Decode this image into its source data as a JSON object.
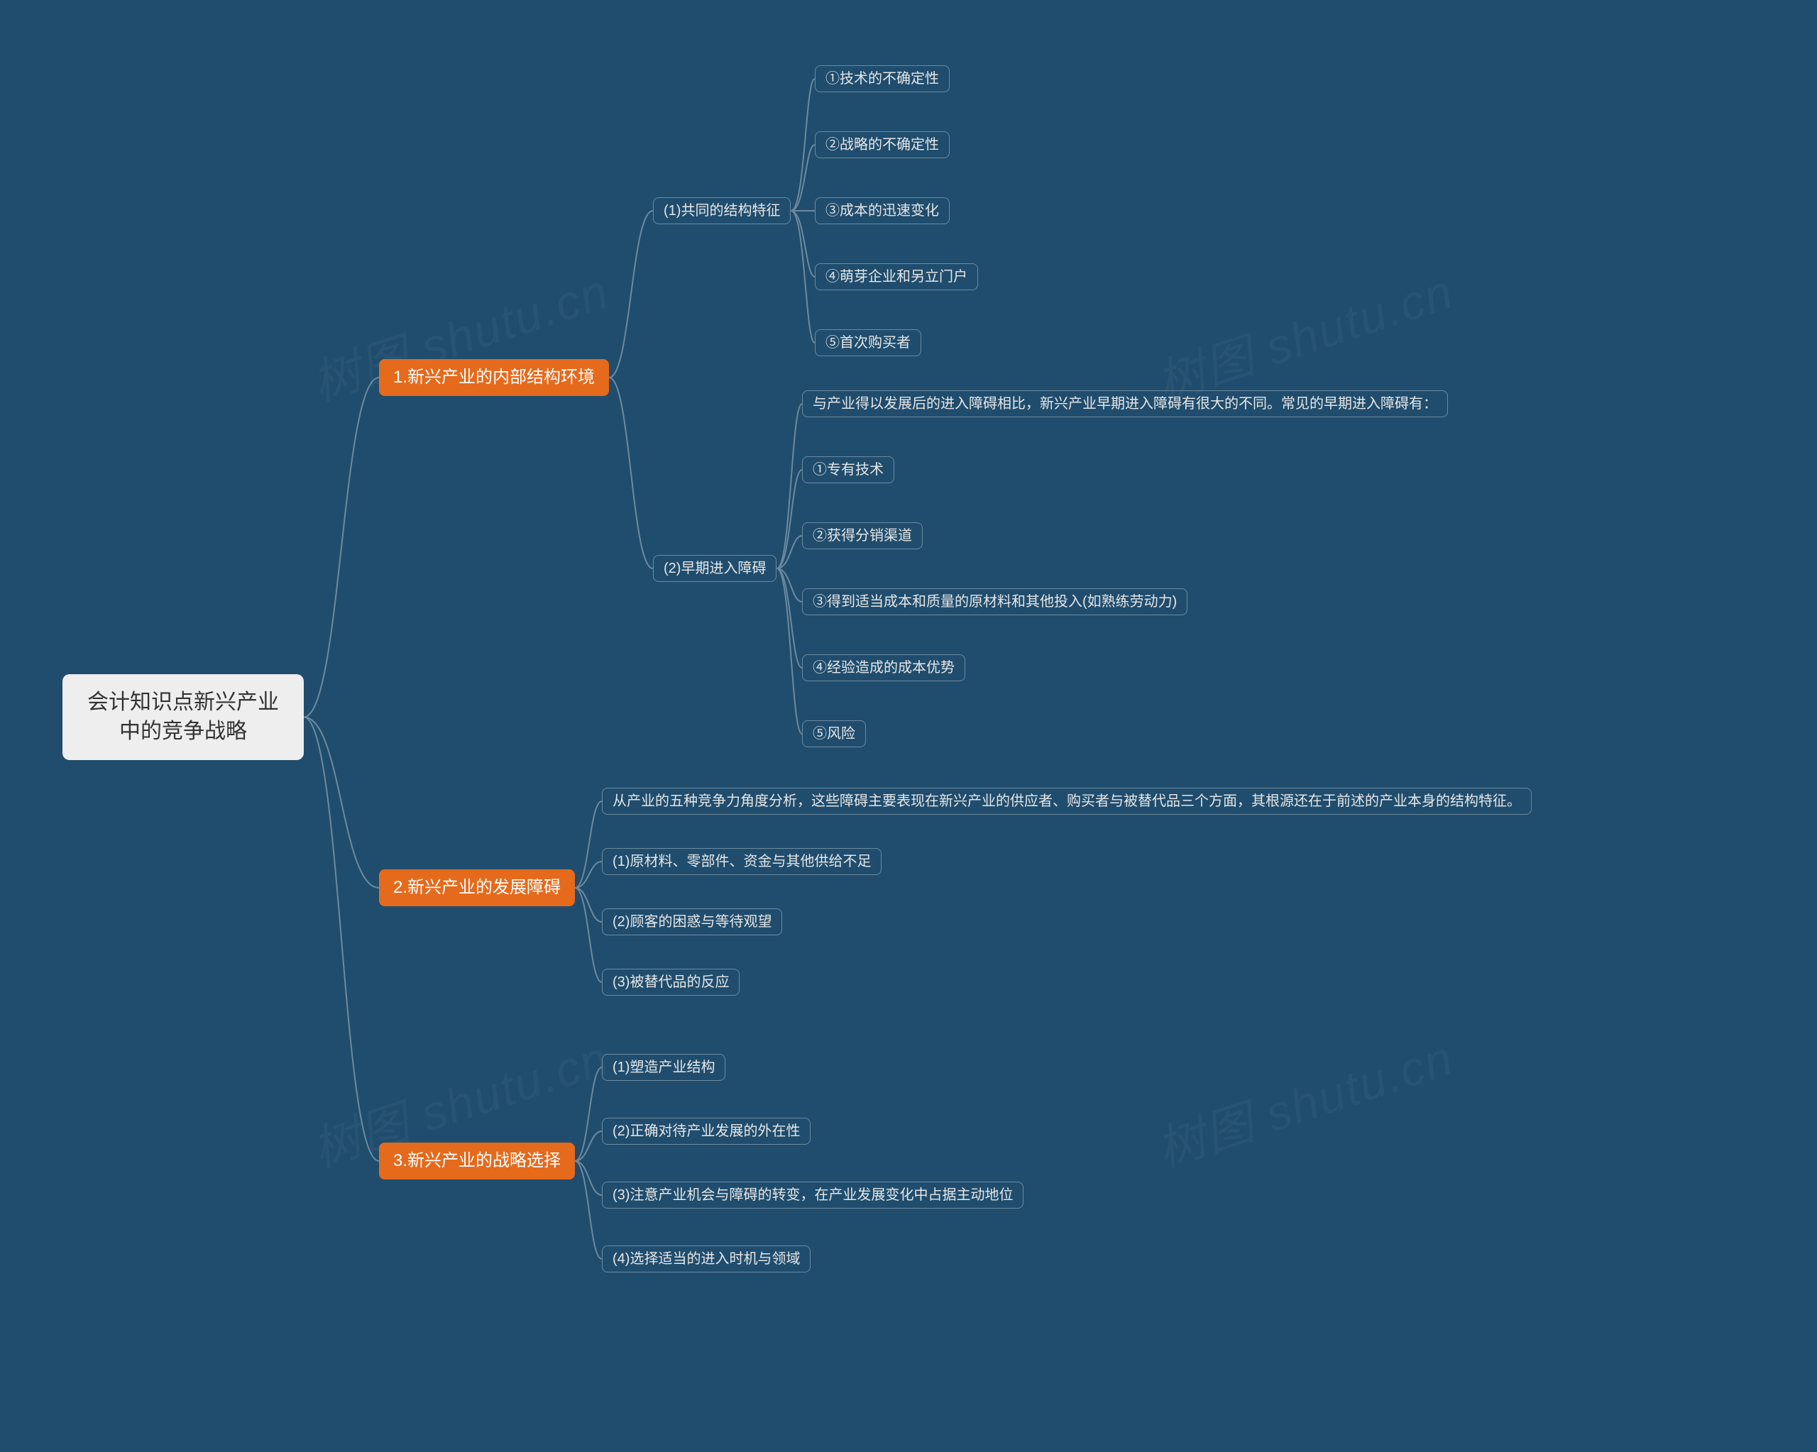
{
  "root": "会计知识点新兴产业中的竞争战略",
  "branches": [
    {
      "label": "1.新兴产业的内部结构环境",
      "children": [
        {
          "label": "(1)共同的结构特征",
          "children": [
            {
              "label": "①技术的不确定性"
            },
            {
              "label": "②战略的不确定性"
            },
            {
              "label": "③成本的迅速变化"
            },
            {
              "label": "④萌芽企业和另立门户"
            },
            {
              "label": "⑤首次购买者"
            }
          ]
        },
        {
          "label": "(2)早期进入障碍",
          "children": [
            {
              "label": "与产业得以发展后的进入障碍相比，新兴产业早期进入障碍有很大的不同。常见的早期进入障碍有："
            },
            {
              "label": "①专有技术"
            },
            {
              "label": "②获得分销渠道"
            },
            {
              "label": "③得到适当成本和质量的原材料和其他投入(如熟练劳动力)"
            },
            {
              "label": "④经验造成的成本优势"
            },
            {
              "label": "⑤风险"
            }
          ]
        }
      ]
    },
    {
      "label": "2.新兴产业的发展障碍",
      "children": [
        {
          "label": "从产业的五种竞争力角度分析，这些障碍主要表现在新兴产业的供应者、购买者与被替代品三个方面，其根源还在于前述的产业本身的结构特征。"
        },
        {
          "label": "(1)原材料、零部件、资金与其他供给不足"
        },
        {
          "label": "(2)顾客的困惑与等待观望"
        },
        {
          "label": "(3)被替代品的反应"
        }
      ]
    },
    {
      "label": "3.新兴产业的战略选择",
      "children": [
        {
          "label": "(1)塑造产业结构"
        },
        {
          "label": "(2)正确对待产业发展的外在性"
        },
        {
          "label": "(3)注意产业机会与障碍的转变，在产业发展变化中占据主动地位"
        },
        {
          "label": "(4)选择适当的进入时机与领域"
        }
      ]
    }
  ],
  "watermark": "树图 shutu.cn"
}
